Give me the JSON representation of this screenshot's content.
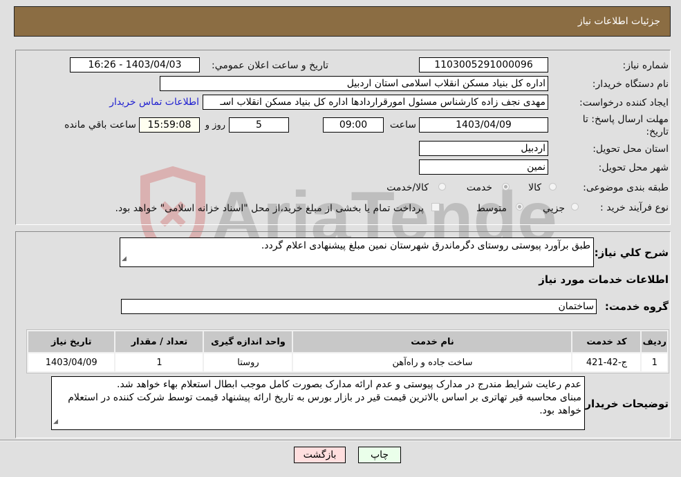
{
  "header": {
    "title": "جزئیات اطلاعات نیاز"
  },
  "fields": {
    "need_number_label": "شماره نیاز:",
    "need_number": "1103005291000096",
    "announce_label": "تاریخ و ساعت اعلان عمومي:",
    "announce_value": "1403/04/03 - 16:26",
    "buyer_org_label": "نام دستگاه خریدار:",
    "buyer_org": "اداره کل بنیاد مسکن انقلاب اسلامی استان اردبیل",
    "creator_label": "ایجاد کننده درخواست:",
    "creator": "مهدی نجف زاده کارشناس مسئول امورقراردادها اداره کل بنیاد مسکن انقلاب اسـ",
    "buyer_contact_link": "اطلاعات تماس خریدار",
    "deadline_label": "مهلت ارسال پاسخ: تا تاریخ:",
    "deadline_date": "1403/04/09",
    "time_label": "ساعت",
    "deadline_time": "09:00",
    "days_value": "5",
    "days_label": "روز و",
    "remaining_time": "15:59:08",
    "remaining_label": "ساعت باقي مانده",
    "province_label": "استان محل تحویل:",
    "province": "اردبیل",
    "city_label": "شهر محل تحویل:",
    "city": "نمین",
    "category_label": "طبقه بندی موضوعی:",
    "category_options": [
      "کالا",
      "خدمت",
      "کالا/خدمت"
    ],
    "category_selected": "خدمت",
    "process_label": "نوع فرآیند خرید :",
    "process_options": [
      "جزيي",
      "متوسط"
    ],
    "process_selected": "متوسط",
    "treasury_note": "پرداخت تمام یا بخشی از مبلغ خرید،از محل \"اسناد خزانه اسلامی\" خواهد بود."
  },
  "description": {
    "label": "شرح كلي نياز:",
    "text": "طبق برآورد پیوستی روستای دگرماندرق شهرستان نمین مبلغ پیشنهادی اعلام گردد."
  },
  "services": {
    "section_title": "اطلاعات خدمات مورد نیاز",
    "group_label": "گروه خدمت:",
    "group_value": "ساختمان",
    "columns": [
      "رديف",
      "کد خدمت",
      "نام خدمت",
      "واحد اندازه گیری",
      "تعداد / مقدار",
      "تاریخ نیاز"
    ],
    "rows": [
      [
        "1",
        "ج-42-421",
        "ساخت جاده و راه‌آهن",
        "روستا",
        "1",
        "1403/04/09"
      ]
    ]
  },
  "buyer_notes": {
    "label": "توضیحات خریدار:",
    "lines": [
      "عدم رعایت شرایط مندرج در مدارک پیوستی و عدم ارائه مدارک بصورت کامل موجب ابطال استعلام بهاء خواهد شد.",
      "مبنای محاسبه قیر تهاتری بر اساس بالاترین قیمت قیر در بازار بورس به تاریخ ارائه پیشنهاد قیمت توسط شرکت کننده در استعلام خواهد بود."
    ]
  },
  "buttons": {
    "print": "چاپ",
    "back": "بازگشت"
  },
  "watermark": {
    "text": "AriaTender.neT"
  },
  "colors": {
    "header_bg": "#8b6d43",
    "link": "#2020d0",
    "print_bg": "#eaffea",
    "back_bg": "#ffdede",
    "remaining_bg": "#fffff0"
  }
}
